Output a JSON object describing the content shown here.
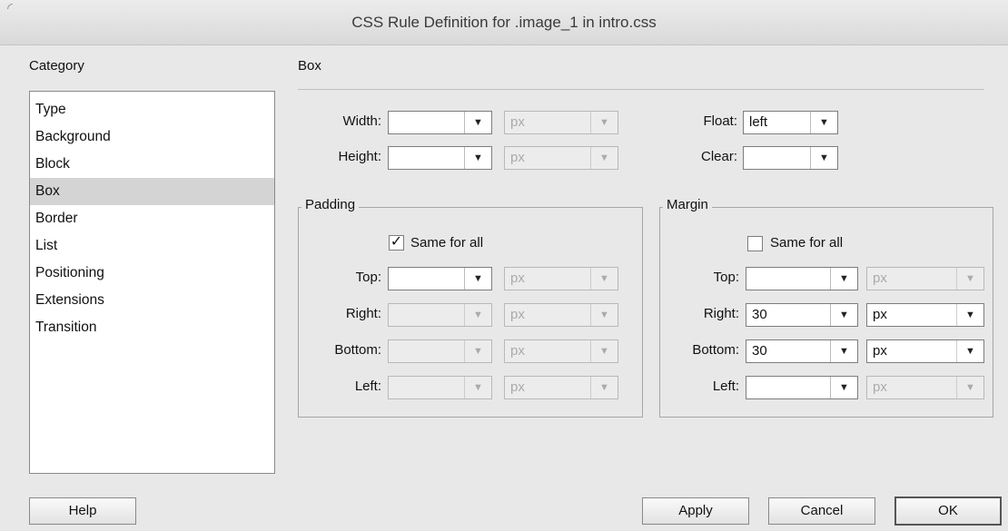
{
  "window": {
    "title": "CSS Rule Definition for .image_1 in intro.css"
  },
  "category": {
    "heading": "Category",
    "items": [
      "Type",
      "Background",
      "Block",
      "Box",
      "Border",
      "List",
      "Positioning",
      "Extensions",
      "Transition"
    ],
    "selected": "Box"
  },
  "box": {
    "title": "Box",
    "width": {
      "label": "Width:",
      "value": "",
      "unit": "px"
    },
    "height": {
      "label": "Height:",
      "value": "",
      "unit": "px"
    },
    "float": {
      "label": "Float:",
      "value": "left"
    },
    "clear": {
      "label": "Clear:",
      "value": ""
    }
  },
  "padding": {
    "title": "Padding",
    "same_for_all_label": "Same for all",
    "same_for_all_checked": true,
    "check_glyph": "✓",
    "top": {
      "label": "Top:",
      "value": "",
      "unit": "px"
    },
    "right": {
      "label": "Right:",
      "value": "",
      "unit": "px"
    },
    "bottom": {
      "label": "Bottom:",
      "value": "",
      "unit": "px"
    },
    "left": {
      "label": "Left:",
      "value": "",
      "unit": "px"
    }
  },
  "margin": {
    "title": "Margin",
    "same_for_all_label": "Same for all",
    "same_for_all_checked": false,
    "top": {
      "label": "Top:",
      "value": "",
      "unit": "px"
    },
    "right": {
      "label": "Right:",
      "value": "30",
      "unit": "px"
    },
    "bottom": {
      "label": "Bottom:",
      "value": "30",
      "unit": "px"
    },
    "left": {
      "label": "Left:",
      "value": "",
      "unit": "px"
    }
  },
  "buttons": {
    "help": "Help",
    "apply": "Apply",
    "cancel": "Cancel",
    "ok": "OK"
  },
  "icons": {
    "dropdown": "▼"
  }
}
